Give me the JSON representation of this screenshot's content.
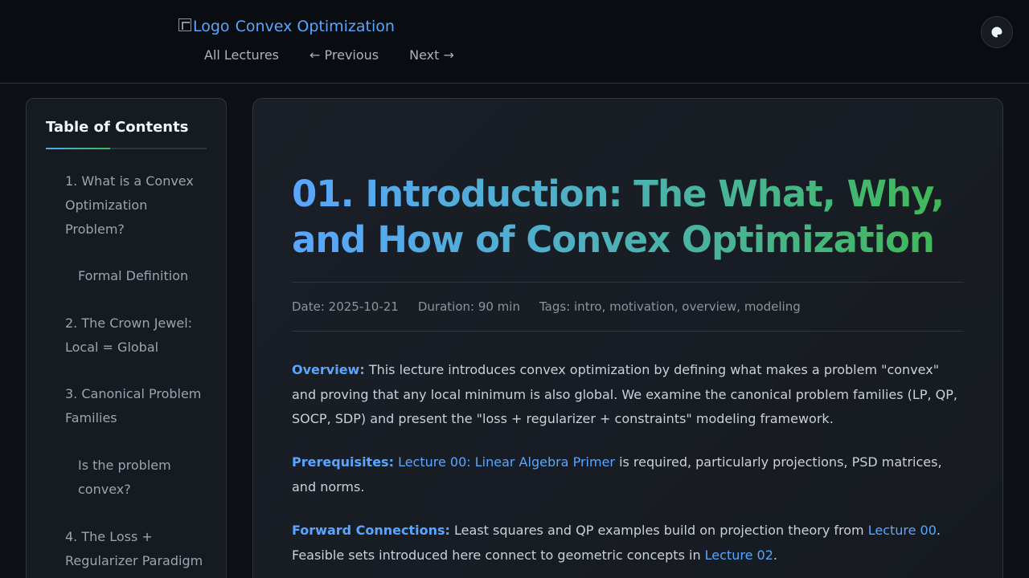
{
  "header": {
    "logo_alt": "Logo",
    "site_title": "Convex Optimization",
    "nav": {
      "all_lectures": "All Lectures",
      "previous": "← Previous",
      "next": "Next →"
    },
    "theme_icon": "palette-icon"
  },
  "toc": {
    "title": "Table of Contents",
    "items": [
      "1. What is a Convex Optimization Problem?",
      "Formal Definition",
      "2. The Crown Jewel: Local = Global",
      "3. Canonical Problem Families",
      "Is the problem convex?",
      "4. The Loss + Regularizer Paradigm"
    ]
  },
  "lecture": {
    "title": "01. Introduction: The What, Why, and How of Convex Optimization",
    "meta": {
      "date": "Date: 2025-10-21",
      "duration": "Duration: 90 min",
      "tags": "Tags: intro, motivation, overview, modeling"
    },
    "overview": {
      "label": "Overview:",
      "text": "This lecture introduces convex optimization by defining what makes a problem \"convex\" and proving that any local minimum is also global. We examine the canonical problem families (LP, QP, SOCP, SDP) and present the \"loss + regularizer + constraints\" modeling framework."
    },
    "prerequisites": {
      "label": "Prerequisites:",
      "link": "Lecture 00: Linear Algebra Primer",
      "text": "is required, particularly projections, PSD matrices, and norms."
    },
    "forward": {
      "label": "Forward Connections:",
      "text1": "Least squares and QP examples build on projection theory from",
      "link1": "Lecture 00",
      "text2": ". Feasible sets introduced here connect to geometric concepts in",
      "link2": "Lecture 02",
      "text3": "."
    }
  }
}
